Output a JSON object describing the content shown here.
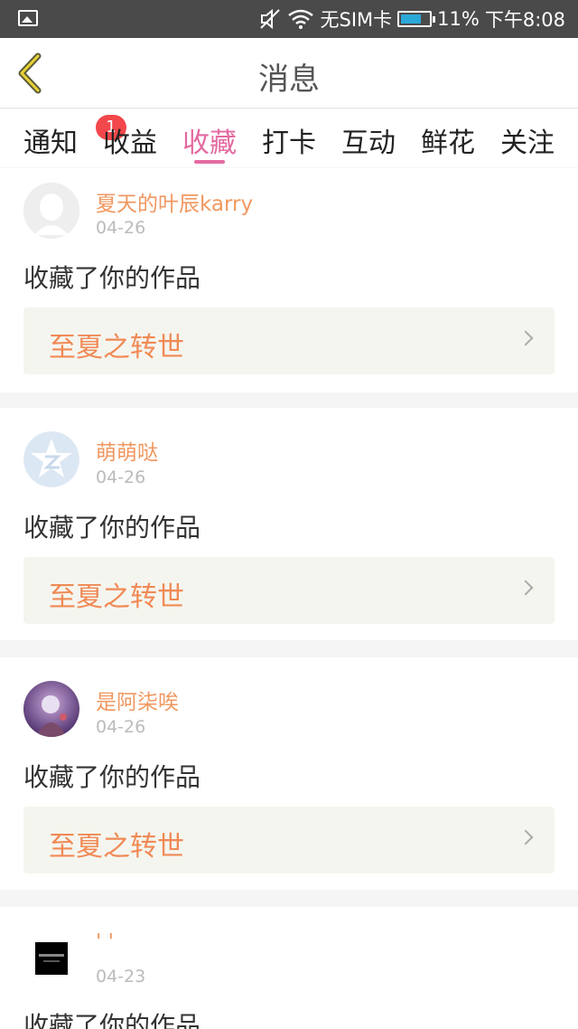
{
  "status_bar": {
    "sim": "无SIM卡",
    "battery": "11%",
    "time": "下午8:08",
    "icons": [
      "gallery-icon",
      "mute-icon",
      "wifi-icon",
      "battery-icon"
    ]
  },
  "header": {
    "title": "消息",
    "back_icon": "chevron-left-icon"
  },
  "tabs": [
    {
      "label": "通知",
      "badge": "1"
    },
    {
      "label": "收益"
    },
    {
      "label": "收藏",
      "active": true
    },
    {
      "label": "打卡"
    },
    {
      "label": "互动"
    },
    {
      "label": "鲜花"
    },
    {
      "label": "关注"
    }
  ],
  "items": [
    {
      "username": "夏天的叶辰karry",
      "date": "04-26",
      "action": "收藏了你的作品",
      "work": "至夏之转世"
    },
    {
      "username": "萌萌哒",
      "date": "04-26",
      "action": "收藏了你的作品",
      "work": "至夏之转世"
    },
    {
      "username": "是阿柒唉",
      "date": "04-26",
      "action": "收藏了你的作品",
      "work": "至夏之转世"
    },
    {
      "username": "' '",
      "date": "04-23",
      "action": "收藏了你的作品"
    }
  ],
  "colors": {
    "accent": "#e46aa1",
    "username": "#f09860",
    "work": "#f08a55",
    "badge": "#f2474b"
  }
}
